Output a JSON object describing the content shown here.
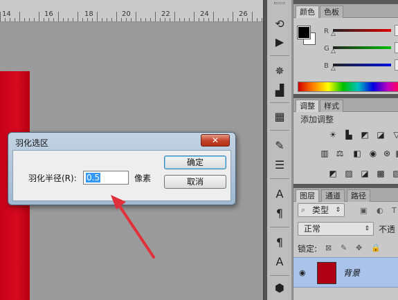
{
  "ruler": {
    "ticks": [
      "14",
      "16",
      "18",
      "20",
      "22",
      "24",
      "26"
    ]
  },
  "colors": {
    "accent_red": "#cc0018",
    "selection_blue": "#aac3ea",
    "dialog_close": "#c5452d"
  },
  "toolstrip": {
    "icons": [
      "history-icon",
      "play-action-icon",
      "navigator-wheel-icon",
      "histogram-icon",
      "3d-layers-icon",
      "brush-presets-icon",
      "brush-settings-icon",
      "character-icon",
      "paragraph-icon",
      "paragraph-styles-icon",
      "clone-source-icon",
      "3d-cube-icon"
    ]
  },
  "color_panel": {
    "tabs": [
      "颜色",
      "色板"
    ],
    "slider_labels": [
      "R",
      "G",
      "B"
    ]
  },
  "adjustments_panel": {
    "tabs": [
      "调整",
      "样式"
    ],
    "title": "添加调整"
  },
  "layers_panel": {
    "tabs": [
      "图层",
      "通道",
      "路径"
    ],
    "filter_label": "类型",
    "blend_mode": "正常",
    "opacity_label": "不透",
    "lock_label": "锁定:",
    "layer_name": "背景"
  },
  "dialog": {
    "title": "羽化选区",
    "close_label": "✕",
    "field_label": "羽化半径(R):",
    "field_value": "0.5",
    "unit": "像素",
    "ok_label": "确定",
    "cancel_label": "取消"
  }
}
